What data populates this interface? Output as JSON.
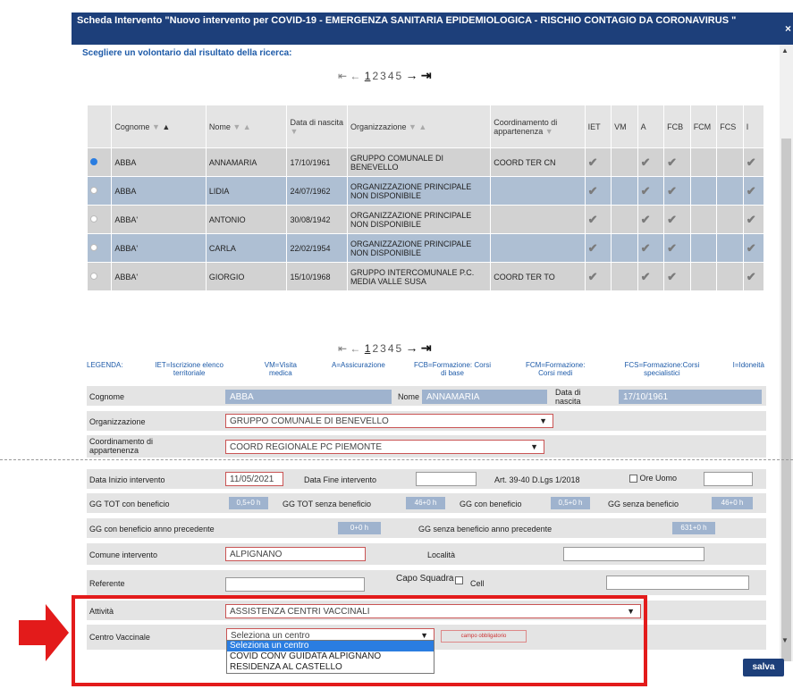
{
  "dialog": {
    "title": "Scheda Intervento \"Nuovo intervento per COVID-19 - EMERGENZA SANITARIA EPIDEMIOLOGICA - RISCHIO CONTAGIO DA CORONAVIRUS \"",
    "close_label": "×",
    "instruction": "Scegliere un volontario dal risultato della ricerca:",
    "save_label": "salva"
  },
  "pager": {
    "first": "⇤",
    "prev": "←",
    "pages": [
      "1",
      "2",
      "3",
      "4",
      "5"
    ],
    "current": "1",
    "next": "→",
    "last": "⇥"
  },
  "table": {
    "headers": {
      "cognome": "Cognome",
      "nome": "Nome",
      "data_nascita": "Data di nascita",
      "organizzazione": "Organizzazione",
      "coordinamento": "Coordinamento di appartenenza",
      "iet": "IET",
      "vm": "VM",
      "a": "A",
      "fcb": "FCB",
      "fcm": "FCM",
      "fcs": "FCS",
      "i": "I"
    },
    "rows": [
      {
        "selected": true,
        "cognome": "ABBA",
        "nome": "ANNAMARIA",
        "data": "17/10/1961",
        "org": "GRUPPO COMUNALE DI BENEVELLO",
        "coord": "COORD TER CN",
        "iet": true,
        "vm": false,
        "a": true,
        "fcb": true,
        "fcm": false,
        "fcs": false,
        "i": true
      },
      {
        "selected": false,
        "cognome": "ABBA",
        "nome": "LIDIA",
        "data": "24/07/1962",
        "org": "ORGANIZZAZIONE PRINCIPALE NON DISPONIBILE",
        "coord": "",
        "iet": true,
        "vm": false,
        "a": true,
        "fcb": true,
        "fcm": false,
        "fcs": false,
        "i": true
      },
      {
        "selected": false,
        "cognome": "ABBA'",
        "nome": "ANTONIO",
        "data": "30/08/1942",
        "org": "ORGANIZZAZIONE PRINCIPALE NON DISPONIBILE",
        "coord": "",
        "iet": true,
        "vm": false,
        "a": true,
        "fcb": true,
        "fcm": false,
        "fcs": false,
        "i": true
      },
      {
        "selected": false,
        "cognome": "ABBA'",
        "nome": "CARLA",
        "data": "22/02/1954",
        "org": "ORGANIZZAZIONE PRINCIPALE NON DISPONIBILE",
        "coord": "",
        "iet": true,
        "vm": false,
        "a": true,
        "fcb": true,
        "fcm": false,
        "fcs": false,
        "i": true
      },
      {
        "selected": false,
        "cognome": "ABBA'",
        "nome": "GIORGIO",
        "data": "15/10/1968",
        "org": "GRUPPO INTERCOMUNALE P.C. MEDIA VALLE SUSA",
        "coord": "COORD TER TO",
        "iet": true,
        "vm": false,
        "a": true,
        "fcb": true,
        "fcm": false,
        "fcs": false,
        "i": true
      }
    ],
    "check_glyph": "✔",
    "radio_on_color": "#2a7de1"
  },
  "legend": {
    "title": "LEGENDA:",
    "items": [
      "IET=Iscrizione elenco territoriale",
      "VM=Visita medica",
      "A=Assicurazione",
      "FCB=Formazione: Corsi di base",
      "FCM=Formazione: Corsi medi",
      "FCS=Formazione:Corsi specialistici",
      "I=Idoneità"
    ]
  },
  "form": {
    "cognome_label": "Cognome",
    "cognome_value": "ABBA",
    "nome_label": "Nome",
    "nome_value": "ANNAMARIA",
    "data_nascita_label": "Data di nascita",
    "data_nascita_value": "17/10/1961",
    "organizzazione_label": "Organizzazione",
    "organizzazione_value": "GRUPPO COMUNALE DI BENEVELLO",
    "coordinamento_label": "Coordinamento di appartenenza",
    "coordinamento_value": "COORD REGIONALE PC PIEMONTE",
    "data_inizio_label": "Data Inizio intervento",
    "data_inizio_value": "11/05/2021",
    "data_fine_label": "Data Fine intervento",
    "data_fine_value": "",
    "art_label": "Art. 39-40 D.Lgs 1/2018",
    "ore_uomo_label": "Ore Uomo",
    "ore_uomo_value": "",
    "gg_tot_con_label": "GG TOT con beneficio",
    "gg_tot_con_value": "0,5+0 h",
    "gg_tot_senza_label": "GG TOT senza beneficio",
    "gg_tot_senza_value": "46+0 h",
    "gg_con_label": "GG con beneficio",
    "gg_con_value": "0,5+0 h",
    "gg_senza_label": "GG senza beneficio",
    "gg_senza_value": "46+0 h",
    "gg_con_prec_label": "GG con beneficio anno precedente",
    "gg_con_prec_value": "0+0 h",
    "gg_senza_prec_label": "GG senza beneficio anno precedente",
    "gg_senza_prec_value": "631+0 h",
    "comune_label": "Comune intervento",
    "comune_value": "ALPIGNANO",
    "localita_label": "Località",
    "localita_value": "",
    "referente_label": "Referente",
    "referente_value": "",
    "capo_squadra_label": "Capo Squadra",
    "cell_label": "Cell",
    "cell_value": "",
    "attivita_label": "Attività",
    "attivita_value": "ASSISTENZA CENTRI VACCINALI",
    "centro_label": "Centro Vaccinale",
    "centro_value": "Seleziona un centro",
    "centro_required": "campo obbligatorio",
    "centro_options": [
      "Seleziona un centro",
      "COVID CONV GUIDATA ALPIGNANO",
      "RESIDENZA AL CASTELLO"
    ]
  },
  "colors": {
    "title_bg": "#1d3f7a",
    "highlight_red": "#e31b1b",
    "row_alt": "#aebfd3",
    "row_gray": "#d2d2d2"
  }
}
